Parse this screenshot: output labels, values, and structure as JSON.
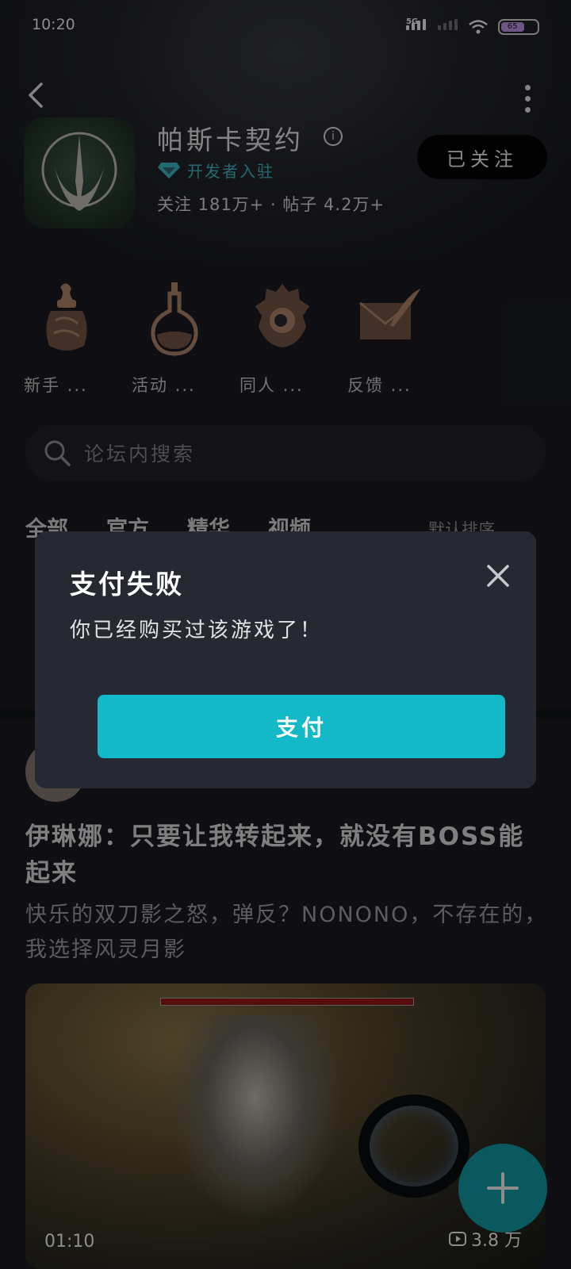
{
  "status_bar": {
    "time": "10:20",
    "network": "5G",
    "battery": "65"
  },
  "header": {
    "app_name": "帕斯卡契约",
    "developer_badge": "开发者入驻",
    "stats": "关注 181万+ · 帖子 4.2万+",
    "follow_label": "已关注"
  },
  "shortcuts": [
    {
      "label": "新手 ...",
      "icon": "potion-jar-icon"
    },
    {
      "label": "活动 ...",
      "icon": "flask-icon"
    },
    {
      "label": "同人 ...",
      "icon": "helmet-icon"
    },
    {
      "label": "反馈 ...",
      "icon": "letter-feather-icon"
    }
  ],
  "search": {
    "placeholder": "论坛内搜索"
  },
  "tabs": [
    "全部",
    "官方",
    "精华",
    "视频"
  ],
  "sort_label": "默认排序",
  "post": {
    "title": "伊琳娜：只要让我转起来，就没有BOSS能起来",
    "body": "快乐的双刀影之怒，弹反？NONONO，不存在的，我选择风灵月影",
    "video_duration": "01:10",
    "video_views": "3.8 万"
  },
  "dialog": {
    "title": "支付失败",
    "message": "你已经购买过该游戏了！",
    "button_label": "支付"
  },
  "colors": {
    "accent": "#13b9c6",
    "fab": "#13a3ad",
    "developer": "#41c2d0"
  }
}
